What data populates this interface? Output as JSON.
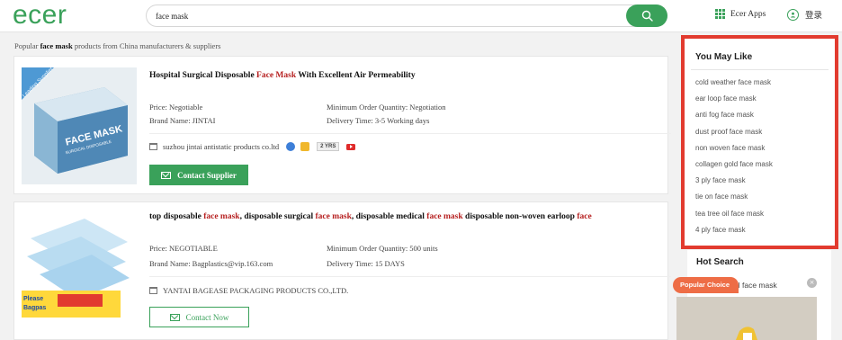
{
  "header": {
    "logo": "ecer",
    "search": {
      "value": "face mask",
      "placeholder": ""
    },
    "apps_label": "Ecer Apps",
    "login_label": "登录"
  },
  "popular": {
    "prefix": "Popular ",
    "keyword": "face mask",
    "suffix": " products from China manufacturers & suppliers"
  },
  "products": [
    {
      "title_parts": [
        {
          "text": "Hospital Surgical Disposable ",
          "hl": false
        },
        {
          "text": "Face Mask",
          "hl": true
        },
        {
          "text": " With Excellent Air Permeability",
          "hl": false
        }
      ],
      "price": "Price: Negotiable",
      "brand": "Brand Name: JINTAI",
      "moq": "Minimum Order Quantity: Negotiation",
      "delivery": "Delivery Time: 3-5 Working days",
      "supplier": "suzhou jintai antistatic products co.ltd",
      "years": "2 YRS",
      "contact_label": "Contact Supplier",
      "image_text": [
        "Leading Supplier",
        "FACE MASK",
        "SURGICAL DISPOSABLE"
      ]
    },
    {
      "title_parts": [
        {
          "text": "top disposable ",
          "hl": false
        },
        {
          "text": "face mask",
          "hl": true
        },
        {
          "text": ", disposable surgical ",
          "hl": false
        },
        {
          "text": "face mask",
          "hl": true
        },
        {
          "text": ", disposable medical ",
          "hl": false
        },
        {
          "text": "face mask",
          "hl": true
        },
        {
          "text": " disposable non-woven earloop ",
          "hl": false
        },
        {
          "text": "face",
          "hl": true
        }
      ],
      "price": "Price: NEGOTIABLE",
      "brand": "Brand Name: Bagplastics@vip.163.com",
      "moq": "Minimum Order Quantity: 500 units",
      "delivery": "Delivery Time: 15 DAYS",
      "supplier": "YANTAI BAGEASE PACKAGING PRODUCTS CO.,LTD.",
      "contact_label": "Contact Now",
      "image_text": [
        "Please",
        "Bagpas"
      ]
    }
  ],
  "you_may_like": {
    "title": "You May Like",
    "items": [
      "cold weather face mask",
      "ear loop face mask",
      "anti fog face mask",
      "dust proof face mask",
      "non woven face mask",
      "collagen gold face mask",
      "3 ply face mask",
      "tie on face mask",
      "tea tree oil face mask",
      "4 ply face mask"
    ]
  },
  "hot_search": {
    "title": "Hot Search",
    "visible_item": "al face mask"
  },
  "popular_choice": {
    "label": "Popular Choice",
    "close": "×"
  },
  "colors": {
    "brand_green": "#3aa15a",
    "highlight_red": "#b72222",
    "frame_red": "#e23b2f",
    "popular_orange": "#ee6d46"
  }
}
